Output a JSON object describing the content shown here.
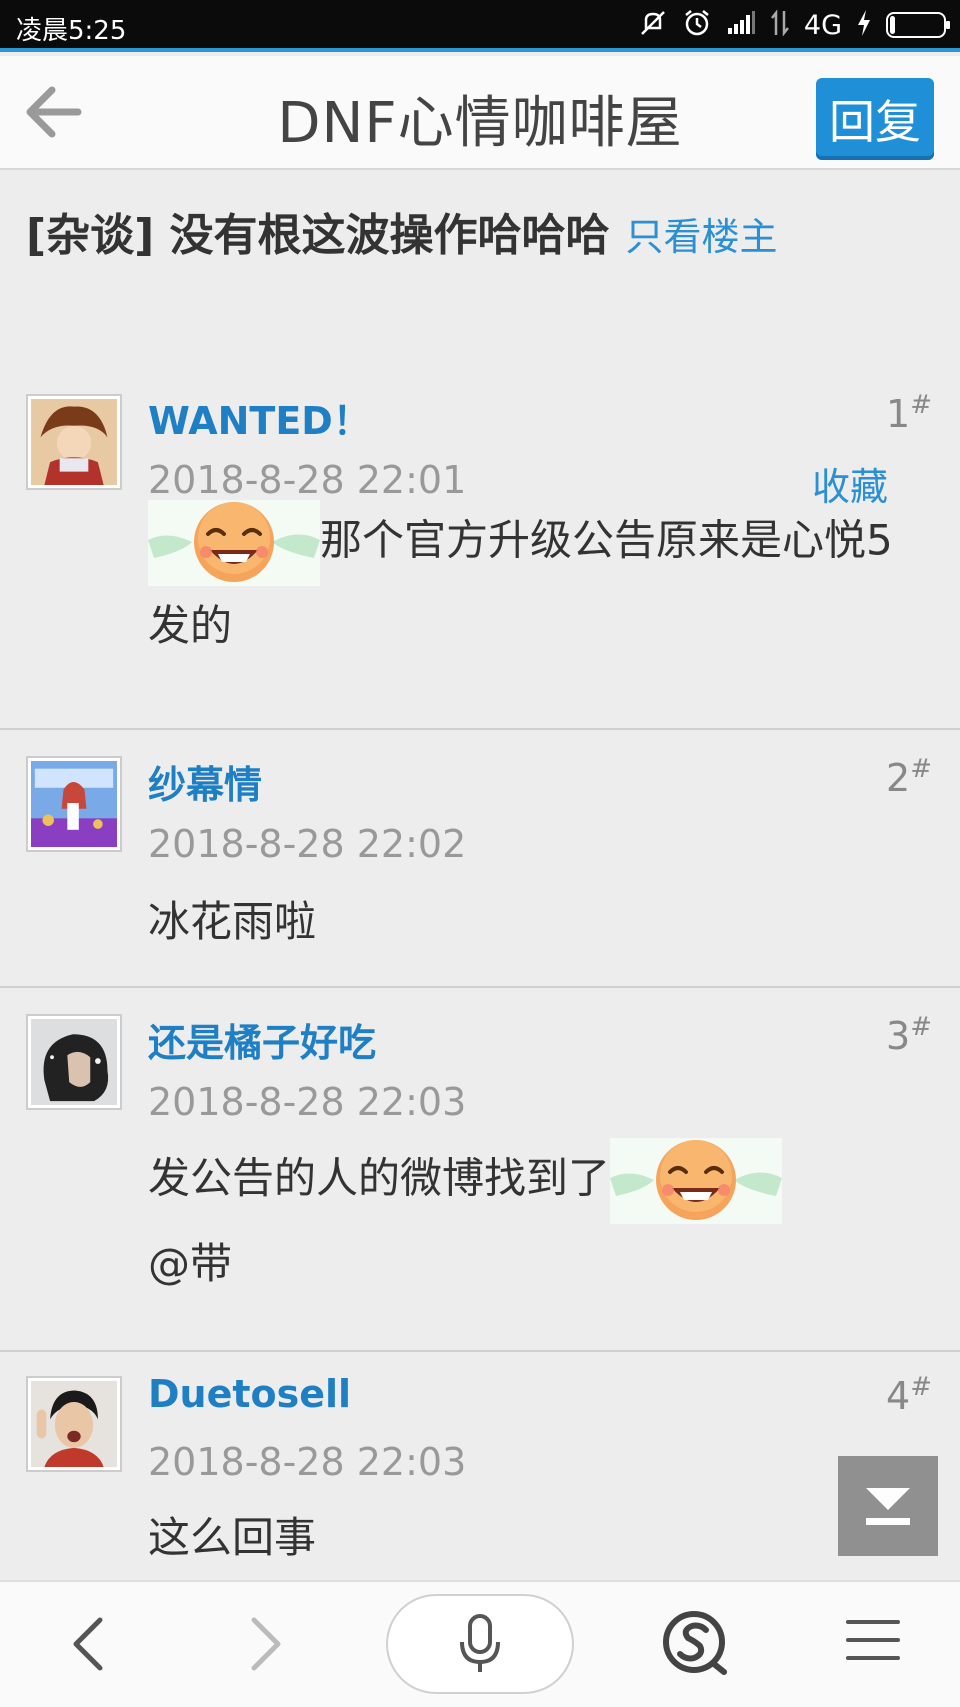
{
  "status_bar": {
    "time": "凌晨5:25",
    "network": "4G",
    "icons": [
      "mute-icon",
      "alarm-icon",
      "signal-icon",
      "data-icon",
      "charging-icon",
      "battery-icon"
    ]
  },
  "header": {
    "title": "DNF心情咖啡屋",
    "reply_label": "回复"
  },
  "thread": {
    "title": "[杂谈] 没有根这波操作哈哈哈",
    "only_op_label": "只看楼主"
  },
  "posts": [
    {
      "author": "WANTED！",
      "floor": "1",
      "floor_mark": "#",
      "time": "2018-8-28 22:01",
      "favorite_label": "收藏",
      "content": "那个官方升级公告原来是心悦5发的"
    },
    {
      "author": "纱幕情",
      "floor": "2",
      "floor_mark": "#",
      "time": "2018-8-28 22:02",
      "content": "冰花雨啦"
    },
    {
      "author": "还是橘子好吃",
      "floor": "3",
      "floor_mark": "#",
      "time": "2018-8-28 22:03",
      "content": "发公告的人的微博找到了",
      "content_tail": "@带"
    },
    {
      "author": "Duetosell",
      "floor": "4",
      "floor_mark": "#",
      "time": "2018-8-28 22:03",
      "content": "这么回事"
    }
  ],
  "colors": {
    "accent": "#1f8fd8",
    "link": "#2a8fd3",
    "author": "#1f7fc4",
    "background": "#ededed"
  }
}
